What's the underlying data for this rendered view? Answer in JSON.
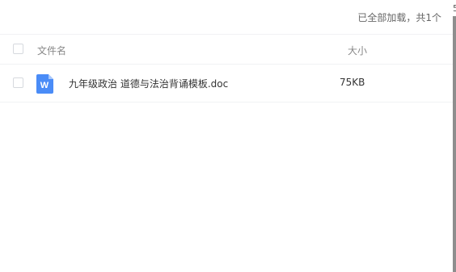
{
  "status": {
    "loaded_text": "已全部加载，共1个"
  },
  "table": {
    "headers": {
      "name": "文件名",
      "size": "大小"
    },
    "rows": [
      {
        "icon": "word-doc-icon",
        "icon_letter": "W",
        "name": "九年级政治 道德与法治背诵模板.doc",
        "size": "75KB"
      }
    ]
  },
  "scrollbar": {
    "edge_char": "5"
  },
  "colors": {
    "doc_icon": "#4a8cf7",
    "scrollbar": "#8e8e8e",
    "divider": "#f1f2f4"
  }
}
